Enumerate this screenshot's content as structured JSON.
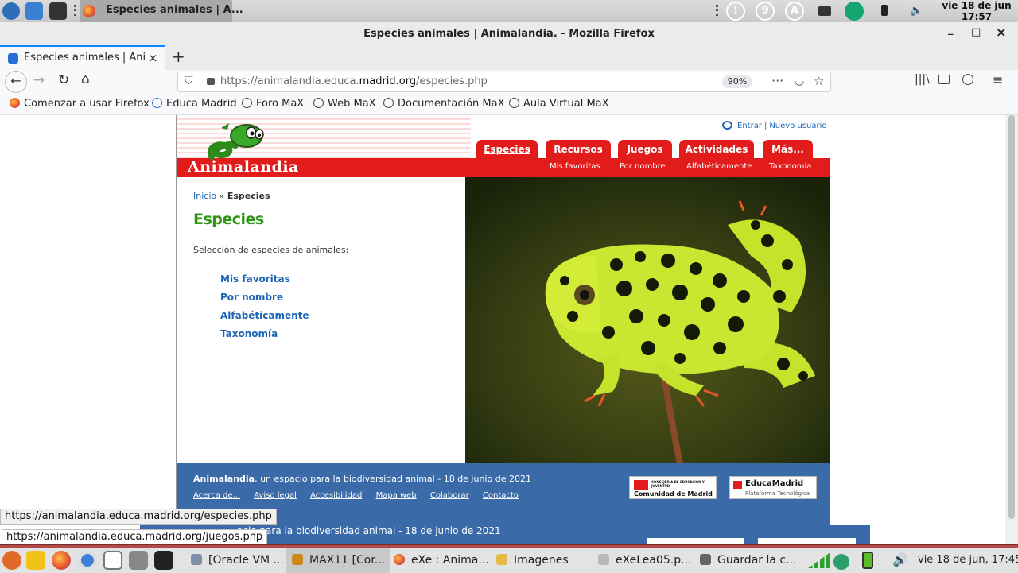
{
  "top_panel": {
    "task_label": "Especies animales | A...",
    "indicator_9": "9",
    "indicator_a": "A",
    "clock_date": "vie 18 de jun",
    "clock_time": "17:57"
  },
  "window": {
    "title": "Especies animales | Animalandia. - Mozilla Firefox",
    "minimize": "_",
    "maximize": "□",
    "close": "×"
  },
  "tab": {
    "label": "Especies animales | Animalandia.",
    "close": "×",
    "new_tab": "+"
  },
  "nav": {
    "url_prefix": "https://animalandia.educa.",
    "url_domain": "madrid.org",
    "url_path": "/especies.php",
    "zoom": "90%"
  },
  "bookmarks": [
    {
      "label": "Comenzar a usar Firefox"
    },
    {
      "label": "Educa Madrid"
    },
    {
      "label": "Foro MaX"
    },
    {
      "label": "Web MaX"
    },
    {
      "label": "Documentación MaX"
    },
    {
      "label": "Aula Virtual MaX"
    }
  ],
  "site": {
    "logo": "Animalandia",
    "login": "Entrar",
    "new_user": "Nuevo usuario",
    "menu": [
      {
        "label": "Especies"
      },
      {
        "label": "Recursos"
      },
      {
        "label": "Juegos"
      },
      {
        "label": "Actividades"
      },
      {
        "label": "Más..."
      }
    ],
    "submenu": [
      {
        "label": "Mis favoritas"
      },
      {
        "label": "Por nombre"
      },
      {
        "label": "Alfabéticamente"
      },
      {
        "label": "Taxonomía"
      }
    ],
    "breadcrumb_home": "Inicio",
    "breadcrumb_sep": "»",
    "breadcrumb_current": "Especies",
    "page_title": "Especies",
    "intro": "Selección de especies de animales:",
    "links": [
      {
        "label": "Mis favoritas"
      },
      {
        "label": "Por nombre"
      },
      {
        "label": "Alfabéticamente"
      },
      {
        "label": "Taxonomía"
      }
    ],
    "footer_brand": "Animalandia",
    "footer_text": ", un espacio para la biodiversidad animal - 18 de junio de 2021",
    "footer_links": [
      {
        "label": "Acerca de..."
      },
      {
        "label": "Aviso legal"
      },
      {
        "label": "Accesibilidad"
      },
      {
        "label": "Mapa web"
      },
      {
        "label": "Colaborar"
      },
      {
        "label": "Contacto"
      }
    ],
    "partner1_small": "CONSEJERÍA DE EDUCACIÓN Y JUVENTUD",
    "partner1_name": "Comunidad de Madrid",
    "partner2_name": "EducaMadrid",
    "partner2_sub": "Plataforma Tecnológica",
    "ghost_text": "acio para la biodiversidad animal - 18 de junio de 2021"
  },
  "status": {
    "link1": "https://animalandia.educa.madrid.org/especies.php",
    "link2": "https://animalandia.educa.madrid.org/juegos.php"
  },
  "taskbar": {
    "tasks": [
      {
        "label": "[Oracle VM ..."
      },
      {
        "label": "MAX11 [Cor..."
      },
      {
        "label": "eXe : Anima..."
      },
      {
        "label": "Imagenes"
      },
      {
        "label": "eXeLea05.p..."
      },
      {
        "label": "Guardar la c..."
      }
    ],
    "clock": "vie 18 de jun, 17:45"
  },
  "colors": {
    "brand_red": "#e21b1b",
    "brand_green": "#2e9612",
    "link_blue": "#1c66b5",
    "footer_blue": "#3a6aa8"
  }
}
